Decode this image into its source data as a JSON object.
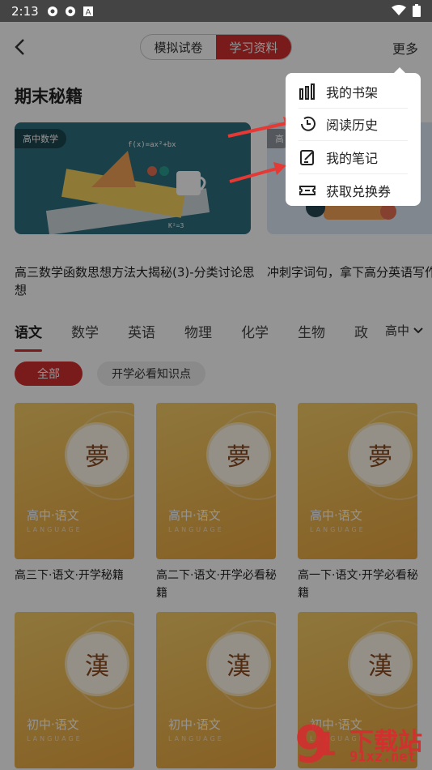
{
  "status_bar": {
    "time": "2:13"
  },
  "header": {
    "tabs": [
      {
        "label": "模拟试卷"
      },
      {
        "label": "学习资料"
      }
    ],
    "more_label": "更多"
  },
  "section": {
    "title": "期末秘籍"
  },
  "cards": [
    {
      "tag": "高中数学",
      "title": "高三数学函数思想方法大揭秘(3)-分类讨论思想"
    },
    {
      "tag": "高",
      "title": "冲刺字词句，拿下高分英语写作"
    }
  ],
  "subjects": [
    "语文",
    "数学",
    "英语",
    "物理",
    "化学",
    "生物",
    "政"
  ],
  "grade_selector": "高中",
  "filter_chips": [
    "全部",
    "开学必看知识点"
  ],
  "books": [
    {
      "cover_char": "夢",
      "cover_label": "高中·语文",
      "cover_eng": "LANGUAGE",
      "title": "高三下·语文·开学秘籍"
    },
    {
      "cover_char": "夢",
      "cover_label": "高中·语文",
      "cover_eng": "LANGUAGE",
      "title": "高二下·语文·开学必看秘籍"
    },
    {
      "cover_char": "夢",
      "cover_label": "高中·语文",
      "cover_eng": "LANGUAGE",
      "title": "高一下·语文·开学必看秘籍"
    },
    {
      "cover_char": "漢",
      "cover_label": "初中·语文",
      "cover_eng": "LANGUAGE",
      "title": ""
    },
    {
      "cover_char": "漢",
      "cover_label": "初中·语文",
      "cover_eng": "LANGUAGE",
      "title": ""
    },
    {
      "cover_char": "漢",
      "cover_label": "初中·语文",
      "cover_eng": "LANGUAGE",
      "title": ""
    }
  ],
  "dropdown_menu": {
    "items": [
      {
        "label": "我的书架",
        "icon": "bookshelf-icon"
      },
      {
        "label": "阅读历史",
        "icon": "history-icon"
      },
      {
        "label": "我的笔记",
        "icon": "notes-icon"
      },
      {
        "label": "获取兑换券",
        "icon": "coupon-icon"
      }
    ]
  },
  "watermark": {
    "text": "下载站",
    "url": "91xz.net"
  },
  "colors": {
    "accent": "#d32f2f",
    "book_cover": "#f0b84e"
  }
}
